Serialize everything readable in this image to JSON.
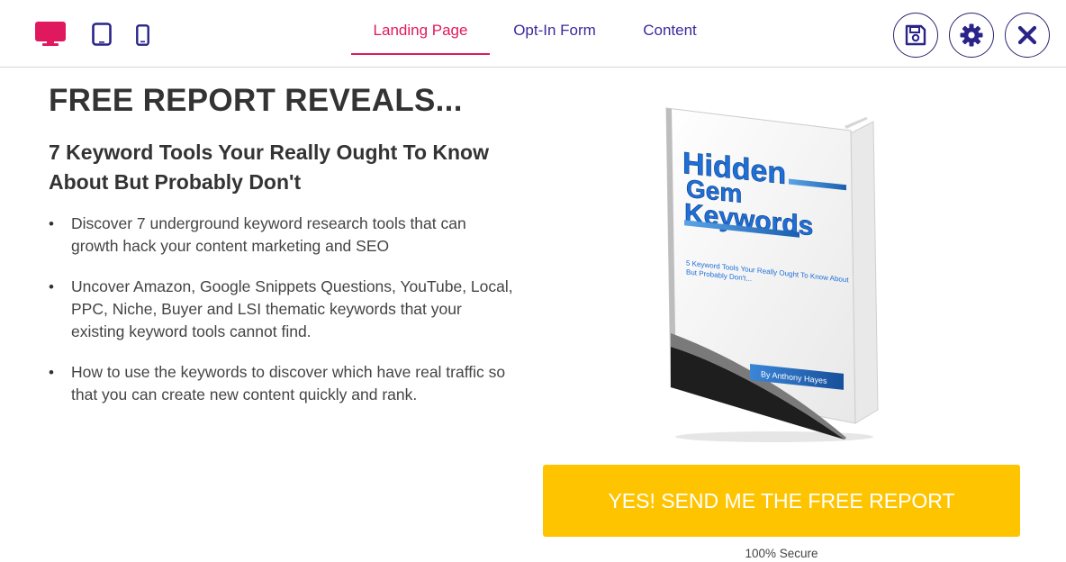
{
  "toolbar": {
    "devices": [
      "desktop-icon",
      "tablet-icon",
      "mobile-icon"
    ],
    "active_device": "desktop",
    "tabs": [
      {
        "label": "Landing Page",
        "active": true
      },
      {
        "label": "Opt-In Form",
        "active": false
      },
      {
        "label": "Content",
        "active": false
      }
    ],
    "actions": [
      "save-icon",
      "gear-icon",
      "close-icon"
    ],
    "colors": {
      "active": "#e0195f",
      "inactive": "#3a2a9c",
      "action_border": "#2a2470"
    }
  },
  "page": {
    "headline": "FREE REPORT REVEALS...",
    "subheadline": "7 Keyword Tools Your Really Ought To Know About But Probably Don't",
    "bullets": [
      "Discover 7 underground keyword research tools that can growth hack your content marketing and SEO",
      "Uncover Amazon, Google Snippets Questions, YouTube, Local, PPC, Niche, Buyer and LSI thematic keywords that your existing keyword tools cannot find.",
      "How to use the keywords to discover which have real traffic so that you can create new content quickly and rank."
    ],
    "bullet_symbol": "•",
    "ebook": {
      "title_lines": [
        "Hidden",
        "Gem",
        "Keywords"
      ],
      "subtitle_lines": [
        "5 Keyword Tools Your Really Ought To Know About",
        "But Probably Don't..."
      ],
      "author": "By Anthony Hayes"
    },
    "cta_label": "YES! SEND ME THE FREE REPORT",
    "cta_color": "#ffc400",
    "secure_note": "100% Secure"
  }
}
